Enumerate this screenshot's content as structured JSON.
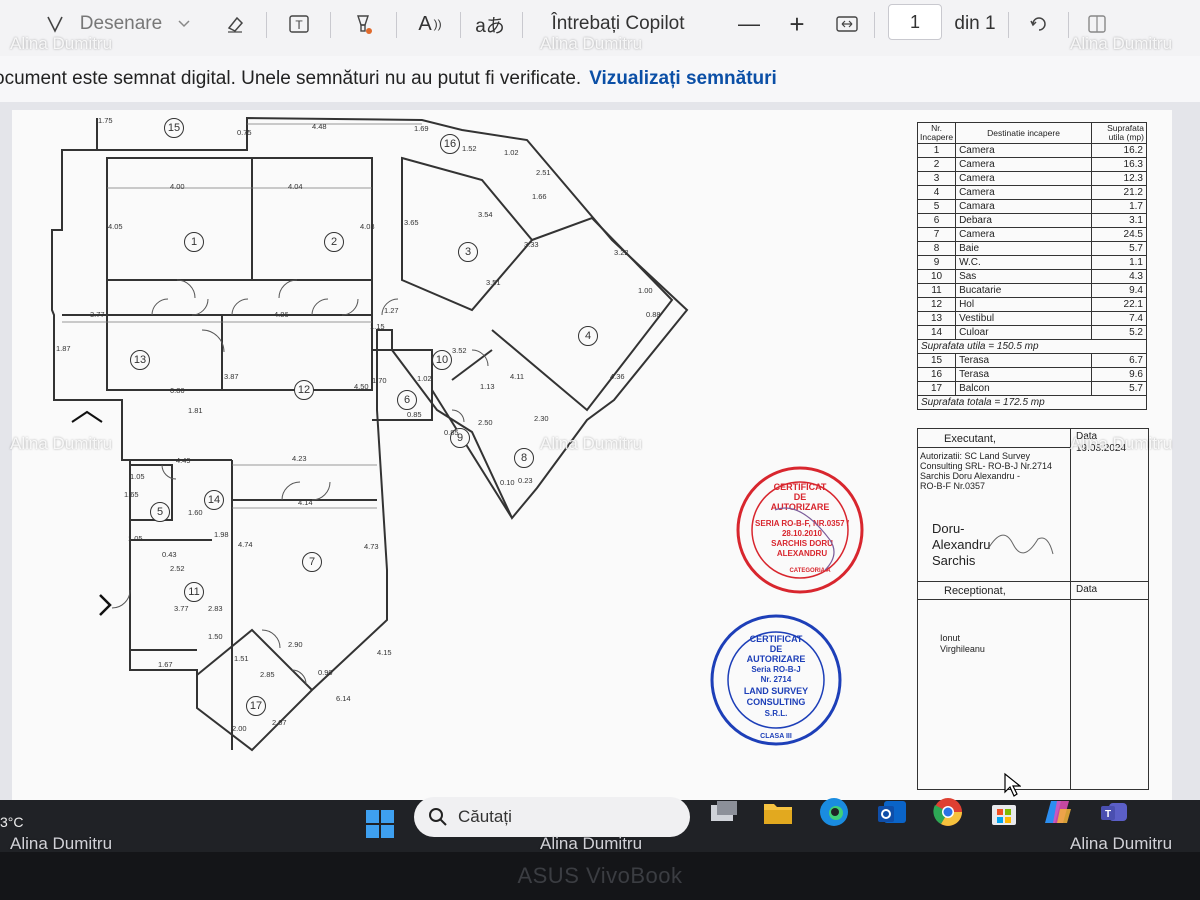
{
  "toolbar": {
    "draw_label": "Desenare",
    "copilot_label": "Întrebați Copilot",
    "zoom_out": "—",
    "zoom_in": "+",
    "page_number": "1",
    "page_total": "din 1",
    "read_aloud_label": "A",
    "translate_label": "aあ",
    "text_label": "T"
  },
  "signature_bar": {
    "message": "ocument este semnat digital. Unele semnături nu au putut fi verificate.",
    "link": "Vizualizați semnături"
  },
  "floorplan": {
    "room_numbers": [
      "1",
      "2",
      "3",
      "4",
      "5",
      "6",
      "7",
      "8",
      "9",
      "10",
      "11",
      "12",
      "13",
      "14",
      "15",
      "16",
      "17"
    ],
    "dimensions": [
      "1.75",
      "0.75",
      "4.48",
      "1.69",
      "1.52",
      "1.02",
      "2.51",
      "1.66",
      "4.00",
      "4.04",
      "4.05",
      "4.03",
      "3.65",
      "3.54",
      "3.33",
      "3.22",
      "1.00",
      "0.88",
      "3.77",
      "4.86",
      "1.27",
      "1.15",
      "3.51",
      "3.52",
      "1.87",
      "0.86",
      "1.81",
      "3.87",
      "4.50",
      "1.70",
      "1.02",
      "0.85",
      "0.85",
      "1.13",
      "2.50",
      "2.30",
      "4.11",
      "4.36",
      "4.23",
      "4.14",
      "1.05",
      "1.65",
      "1.05",
      "1.60",
      "0.43",
      "2.52",
      "1.98",
      "4.49",
      "4.74",
      "4.73",
      "3.77",
      "2.83",
      "1.50",
      "1.51",
      "2.90",
      "2.85",
      "0.90",
      "1.67",
      "2.07",
      "2.00",
      "4.15",
      "6.14",
      "0.10",
      "0.23"
    ]
  },
  "legend": {
    "headers": [
      "Nr. Incapere",
      "Destinatie incapere",
      "Suprafata utila (mp)"
    ],
    "rooms": [
      {
        "nr": "1",
        "name": "Camera",
        "area": "16.2"
      },
      {
        "nr": "2",
        "name": "Camera",
        "area": "16.3"
      },
      {
        "nr": "3",
        "name": "Camera",
        "area": "12.3"
      },
      {
        "nr": "4",
        "name": "Camera",
        "area": "21.2"
      },
      {
        "nr": "5",
        "name": "Camara",
        "area": "1.7"
      },
      {
        "nr": "6",
        "name": "Debara",
        "area": "3.1"
      },
      {
        "nr": "7",
        "name": "Camera",
        "area": "24.5"
      },
      {
        "nr": "8",
        "name": "Baie",
        "area": "5.7"
      },
      {
        "nr": "9",
        "name": "W.C.",
        "area": "1.1"
      },
      {
        "nr": "10",
        "name": "Sas",
        "area": "4.3"
      },
      {
        "nr": "11",
        "name": "Bucatarie",
        "area": "9.4"
      },
      {
        "nr": "12",
        "name": "Hol",
        "area": "22.1"
      },
      {
        "nr": "13",
        "name": "Vestibul",
        "area": "7.4"
      },
      {
        "nr": "14",
        "name": "Culoar",
        "area": "5.2"
      }
    ],
    "useful_total": "Suprafata utila = 150.5 mp",
    "outdoor": [
      {
        "nr": "15",
        "name": "Terasa",
        "area": "6.7"
      },
      {
        "nr": "16",
        "name": "Terasa",
        "area": "9.6"
      },
      {
        "nr": "17",
        "name": "Balcon",
        "area": "5.7"
      }
    ],
    "grand_total": "Suprafata totala = 172.5 mp"
  },
  "signatures": {
    "executant_label": "Executant,",
    "data_label": "Data",
    "data_value": "19.08.2024",
    "authorization_line1": "Autorizatii: SC Land Survey",
    "authorization_line2": "Consulting SRL- RO-B-J Nr.2714",
    "authorization_line3": "Sarchis Doru Alexandru -",
    "authorization_line4": "RO-B-F Nr.0357",
    "signer_first": "Doru-",
    "signer_middle": "Alexandru",
    "signer_last": "Sarchis",
    "receptionat_label": "Receptionat,",
    "data_label_2": "Data",
    "receiver_first": "Ionut",
    "receiver_last": "Virghileanu"
  },
  "stamp_red": {
    "line1": "CERTIFICAT",
    "line2": "DE",
    "line3": "AUTORIZARE",
    "line4": "SERIA RO-B-F, NR.0357 /",
    "line5": "28.10.2010",
    "line6": "SARCHIS DORU",
    "line7": "ALEXANDRU",
    "line8": "CATEGORIA A"
  },
  "stamp_blue": {
    "line1": "CERTIFICAT",
    "line2": "DE",
    "line3": "AUTORIZARE",
    "line4": "Seria RO-B-J",
    "line5": "Nr. 2714",
    "line6": "LAND SURVEY",
    "line7": "CONSULTING",
    "line8": "S.R.L.",
    "line9": "CLASA III"
  },
  "taskbar": {
    "weather_temp": "3°C",
    "search_placeholder": "Căutați",
    "icons": [
      "windows-start",
      "task-view",
      "file-explorer",
      "edge",
      "outlook",
      "chrome",
      "store",
      "copilot",
      "teams"
    ]
  },
  "bezel_brand": "ASUS VivoBook",
  "watermark": "Alina Dumitru",
  "colors": {
    "toolbar_bg": "#f3f3f5",
    "link": "#0b4fa6",
    "taskbar_bg": "#202226",
    "stamp_red": "#d8262e",
    "stamp_blue": "#1d3fb8"
  }
}
